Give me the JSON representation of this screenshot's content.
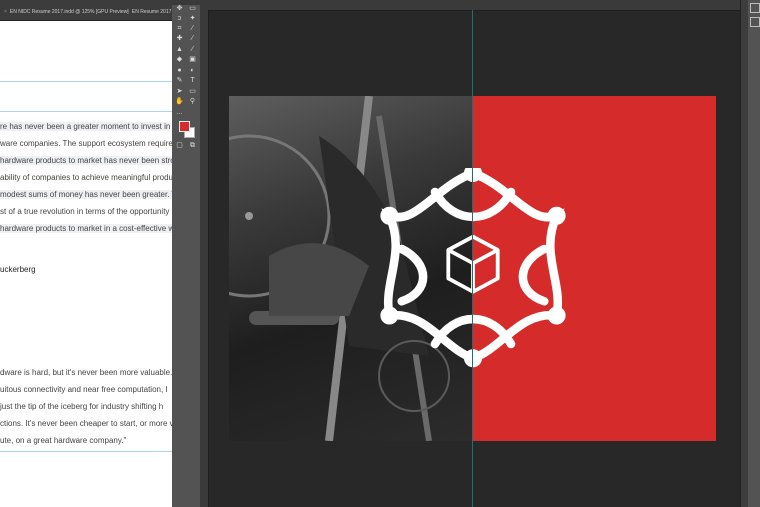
{
  "tabs": [
    {
      "label": "EN NIDC Resume 2017.indd @ 125% [GPU Preview]"
    },
    {
      "label": "EN Resume 2017"
    }
  ],
  "document": {
    "para1": [
      "re has never been a greater moment to invest in",
      "ware companies. The support ecosystem required",
      "hardware products to market has never been stro",
      "ability of companies to achieve meaningful produ",
      "modest sums of money has never been greater. W",
      "st of a true revolution in terms of the opportunity",
      "hardware products to market in a cost-effective w"
    ],
    "author1": "uckerberg",
    "para2": [
      "dware is hard, but it's never been more valuable.",
      "uitous connectivity and near free computation, I",
      "just the tip of the iceberg for industry shifting h",
      "ctions. It's never been cheaper to start, or more va",
      "ute, on a great hardware company.\""
    ]
  },
  "toolbar": {
    "more_label": "...",
    "tools": [
      "move-tool",
      "artboard-tool",
      "lasso-tool",
      "magic-wand-tool",
      "crop-tool",
      "eyedropper-tool",
      "healing-brush-tool",
      "brush-tool",
      "clone-stamp-tool",
      "history-brush-tool",
      "eraser-tool",
      "gradient-tool",
      "blur-tool",
      "dodge-tool",
      "pen-tool",
      "type-tool",
      "path-selection-tool",
      "rectangle-tool",
      "hand-tool",
      "zoom-tool"
    ],
    "foreground_color": "#d62b2b",
    "background_color": "#ffffff"
  },
  "colors": {
    "brand_red": "#d62b2b",
    "canvas_bg": "#282828",
    "ui_gray": "#535353"
  }
}
